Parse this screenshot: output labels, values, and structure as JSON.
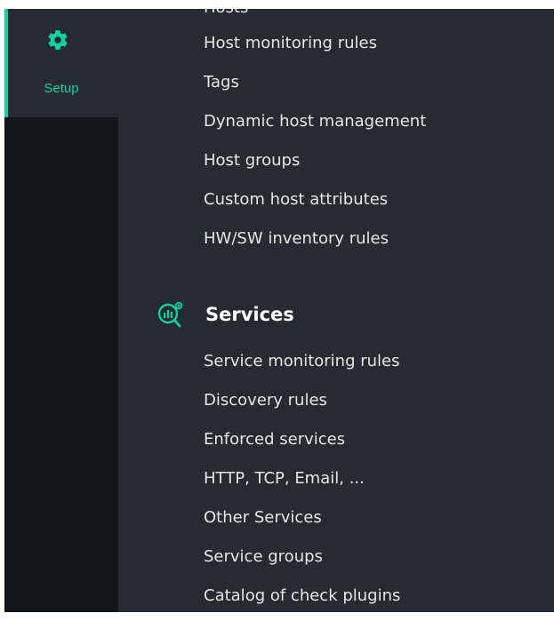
{
  "nav": {
    "setup_label": "Setup",
    "accent_color": "#15d1a0",
    "setup_icon": "gear-icon"
  },
  "hosts_items": [
    "Hosts",
    "Host monitoring rules",
    "Tags",
    "Dynamic host management",
    "Host groups",
    "Custom host attributes",
    "HW/SW inventory rules"
  ],
  "services": {
    "title": "Services",
    "icon": "service-monitoring-icon",
    "items": [
      "Service monitoring rules",
      "Discovery rules",
      "Enforced services",
      "HTTP, TCP, Email, ...",
      "Other Services",
      "Service groups",
      "Catalog of check plugins"
    ]
  }
}
